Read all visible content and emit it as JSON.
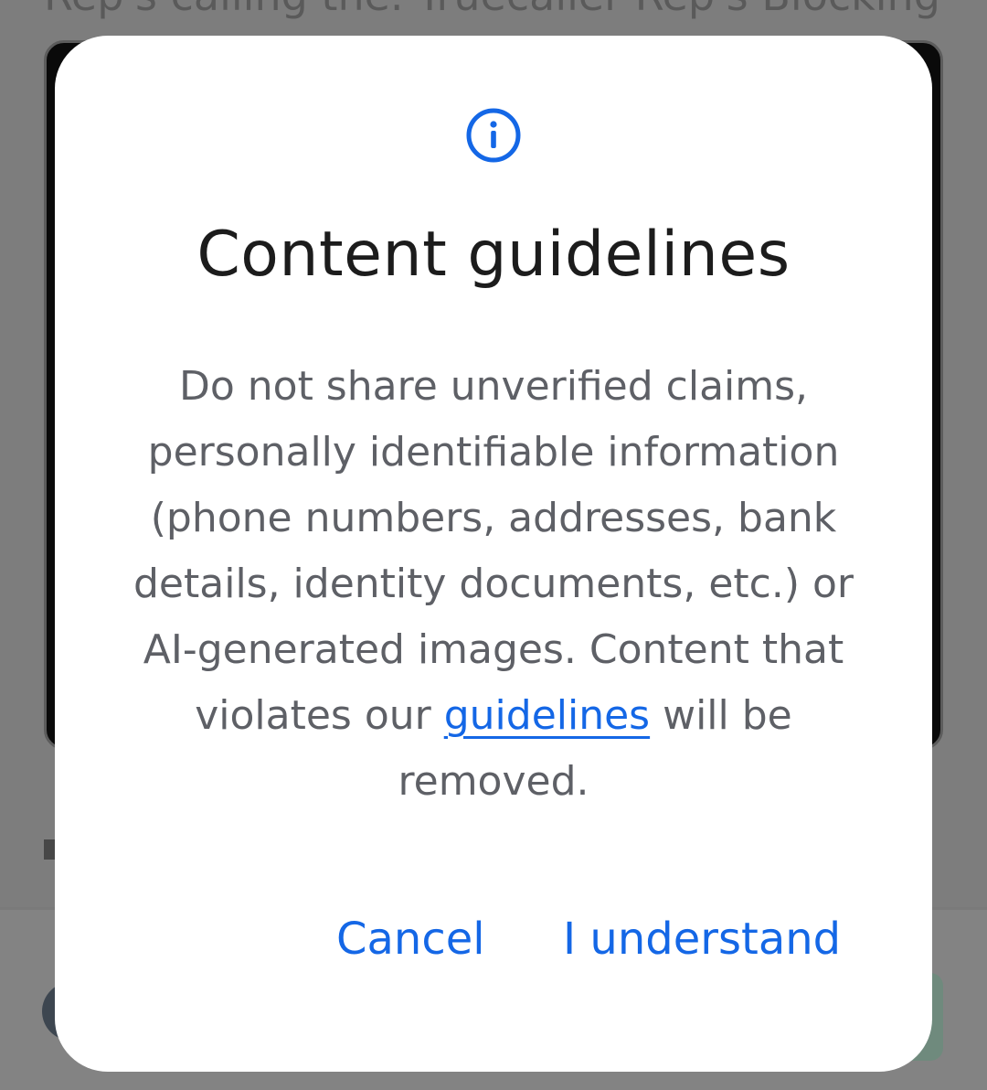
{
  "background": {
    "title_fragment": "Rep's calling the. Truecaller Rep's Blocking"
  },
  "dialog": {
    "icon": "info-icon",
    "title": "Content guidelines",
    "message_before_link": "Do not share unverified claims, personally identifiable information (phone numbers, addresses, bank details, identity documents, etc.) or AI-generated images. Content that violates our ",
    "link_text": "guidelines",
    "message_after_link": " will be removed.",
    "cancel_label": "Cancel",
    "confirm_label": "I understand"
  },
  "colors": {
    "accent": "#1467e6",
    "title": "#1c1c1c",
    "body_text": "#5e6066",
    "scrim": "#7d7d7d",
    "dialog_bg": "#ffffff"
  }
}
